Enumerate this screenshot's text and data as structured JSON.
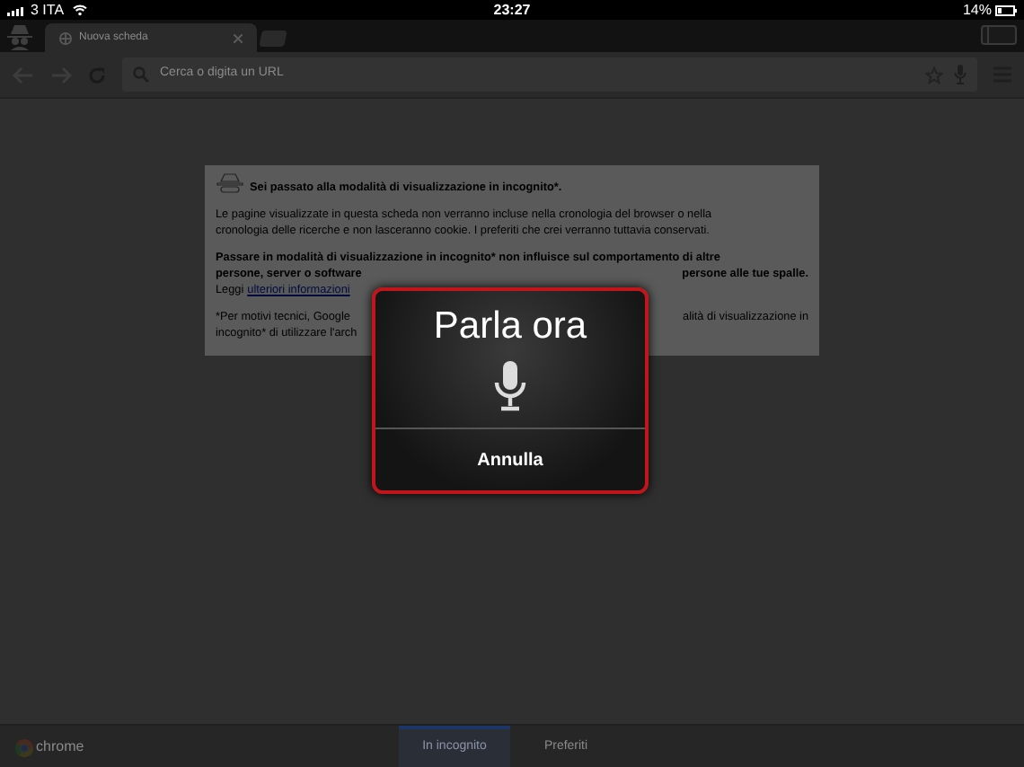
{
  "status_bar": {
    "carrier": "3 ITA",
    "time": "23:27",
    "battery": "14%"
  },
  "tabs": [
    {
      "title": "Nuova scheda",
      "selected": true
    }
  ],
  "omnibox": {
    "placeholder": "Cerca o digita un URL"
  },
  "incognito_card": {
    "heading": "Sei passato alla modalità di visualizzazione in incognito*.",
    "paragraphs": [
      {
        "lines": [
          {
            "bold": false,
            "left": "Le pagine visualizzate in questa scheda non verranno incluse nella cronologia del browser o nella"
          },
          {
            "bold": false,
            "left": "cronologia delle ricerche e non lasceranno cookie. I preferiti che crei verranno tuttavia conservati."
          }
        ]
      },
      {
        "lines": [
          {
            "bold": true,
            "left": "Passare in modalità di visualizzazione in incognito* non influisce sul comportamento di altre"
          },
          {
            "bold": true,
            "left": "persone, server o software",
            "right": "persone alle tue spalle."
          },
          {
            "bold": false,
            "left": "Leggi",
            "link": "ulteriori informazioni"
          }
        ]
      },
      {
        "lines": [
          {
            "bold": false,
            "left": "*Per motivi tecnici, Google",
            "right": "alità di visualizzazione in"
          },
          {
            "bold": false,
            "left": "incognito* di utilizzare l'arch"
          }
        ]
      }
    ]
  },
  "voice_dialog": {
    "title": "Parla ora",
    "cancel": "Annulla"
  },
  "bottom_bar": {
    "logo_text": "chrome",
    "tabs": [
      {
        "label": "In incognito",
        "selected": true
      },
      {
        "label": "Preferiti",
        "selected": false
      }
    ]
  }
}
